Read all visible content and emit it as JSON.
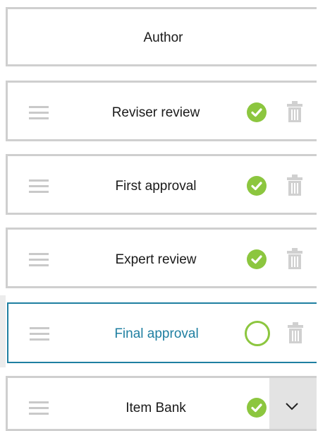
{
  "workflow": {
    "author": {
      "label": "Author"
    },
    "steps": [
      {
        "label": "Reviser review",
        "status": "complete",
        "status_icon": "check-circle-icon",
        "action_icon": "trash-icon"
      },
      {
        "label": "First approval",
        "status": "complete",
        "status_icon": "check-circle-icon",
        "action_icon": "trash-icon"
      },
      {
        "label": "Expert review",
        "status": "complete",
        "status_icon": "check-circle-icon",
        "action_icon": "trash-icon"
      },
      {
        "label": "Final approval",
        "status": "pending",
        "status_icon": "open-circle-icon",
        "action_icon": "trash-icon",
        "active": true
      },
      {
        "label": "Item Bank",
        "status": "complete",
        "status_icon": "check-circle-icon",
        "action_icon": "chevron-down-icon"
      }
    ]
  },
  "colors": {
    "border": "#cfcfcf",
    "active_border": "#1f7fa1",
    "active_text": "#1f7fa1",
    "success": "#8cc63f",
    "handle": "#c9c9c9",
    "trash": "#d0d0d0",
    "dropdown_bg": "#e3e3e3"
  }
}
